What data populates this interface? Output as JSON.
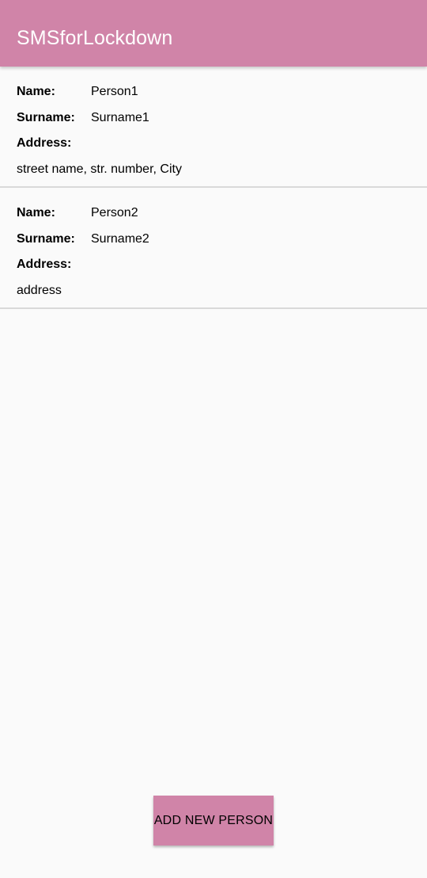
{
  "app": {
    "title": "SMSforLockdown",
    "accent_color": "#d084a8",
    "background_color": "#fafafa"
  },
  "labels": {
    "name": "Name:",
    "surname": "Surname:",
    "address": "Address:"
  },
  "persons": [
    {
      "name": "Person1",
      "surname": "Surname1",
      "address": "street name, str. number, City"
    },
    {
      "name": "Person2",
      "surname": "Surname2",
      "address": "address"
    }
  ],
  "actions": {
    "add_person_label": "ADD NEW PERSON"
  }
}
